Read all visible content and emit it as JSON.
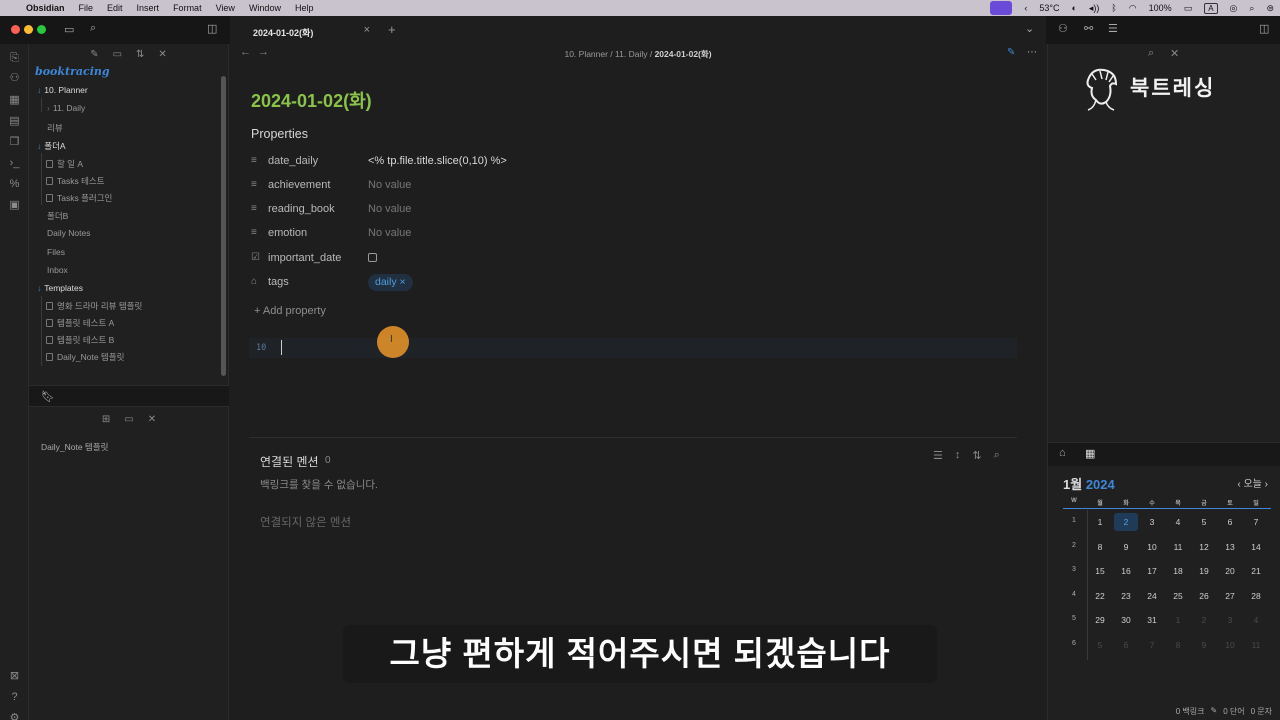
{
  "menubar": {
    "app": "Obsidian",
    "items": [
      "File",
      "Edit",
      "Insert",
      "Format",
      "View",
      "Window",
      "Help"
    ],
    "temp": "53°C",
    "battery": "100%",
    "kbd": "A"
  },
  "tab": {
    "title": "2024-01-02(화)",
    "close": "×",
    "new": "+"
  },
  "breadcrumb": {
    "path": "10. Planner / 11. Daily / ",
    "current": "2024-01-02(화)"
  },
  "sidebar": {
    "vault": "booktracing",
    "items": [
      {
        "label": "10. Planner",
        "kind": "folder-open"
      },
      {
        "label": "11. Daily",
        "kind": "child-folder"
      },
      {
        "label": "리뷰",
        "kind": "folder"
      },
      {
        "label": "폴더A",
        "kind": "folder-open"
      },
      {
        "label": "할 일 A",
        "kind": "file"
      },
      {
        "label": "Tasks 테스트",
        "kind": "file"
      },
      {
        "label": "Tasks 플러그인",
        "kind": "file"
      },
      {
        "label": "폴더B",
        "kind": "folder"
      },
      {
        "label": "Daily Notes",
        "kind": "folder"
      },
      {
        "label": "Files",
        "kind": "folder"
      },
      {
        "label": "Inbox",
        "kind": "folder"
      },
      {
        "label": "Templates",
        "kind": "folder-open"
      },
      {
        "label": "영화 드라마 리뷰 템플릿",
        "kind": "file"
      },
      {
        "label": "템플릿 테스트 A",
        "kind": "file"
      },
      {
        "label": "템플릿 테스트 B",
        "kind": "file"
      },
      {
        "label": "Daily_Note 템플릿",
        "kind": "file"
      }
    ],
    "bookmark": "Daily_Note 템플릿"
  },
  "note": {
    "title": "2024-01-02(화)",
    "properties_heading": "Properties",
    "properties": [
      {
        "key": "date_daily",
        "value": "<% tp.file.title.slice(0,10) %>",
        "icon": "≡"
      },
      {
        "key": "achievement",
        "value": "No value",
        "icon": "≡"
      },
      {
        "key": "reading_book",
        "value": "No value",
        "icon": "≡"
      },
      {
        "key": "emotion",
        "value": "No value",
        "icon": "≡"
      }
    ],
    "checkbox_key": "important_date",
    "tags_key": "tags",
    "tag": "daily ×",
    "add_property": "+ Add property",
    "line_number": "10"
  },
  "backlinks": {
    "title": "연결된 멘션",
    "count": "0",
    "empty": "백링크를 찾을 수 없습니다.",
    "unlinked": "연결되지 않은 멘션"
  },
  "calendar": {
    "month": "1월",
    "year": "2024",
    "nav": "‹ 오늘 ›",
    "headers": [
      "W",
      "월",
      "화",
      "수",
      "목",
      "금",
      "토",
      "일"
    ],
    "weeks": [
      [
        "1",
        "1",
        "2",
        "3",
        "4",
        "5",
        "6",
        "7"
      ],
      [
        "2",
        "8",
        "9",
        "10",
        "11",
        "12",
        "13",
        "14"
      ],
      [
        "3",
        "15",
        "16",
        "17",
        "18",
        "19",
        "20",
        "21"
      ],
      [
        "4",
        "22",
        "23",
        "24",
        "25",
        "26",
        "27",
        "28"
      ],
      [
        "5",
        "29",
        "30",
        "31",
        "1",
        "2",
        "3",
        "4"
      ],
      [
        "6",
        "5",
        "6",
        "7",
        "8",
        "9",
        "10",
        "11"
      ]
    ]
  },
  "logo": {
    "text": "북트레싱"
  },
  "status": {
    "backlinks": "0 백링크",
    "words": "0 단어",
    "chars": "0 문자"
  },
  "subtitle": "그냥 편하게 적어주시면 되겠습니다",
  "colors": {
    "title_green": "#8bc34a",
    "accent_blue": "#3e86d8",
    "cursor_orange": "#eb9628"
  }
}
